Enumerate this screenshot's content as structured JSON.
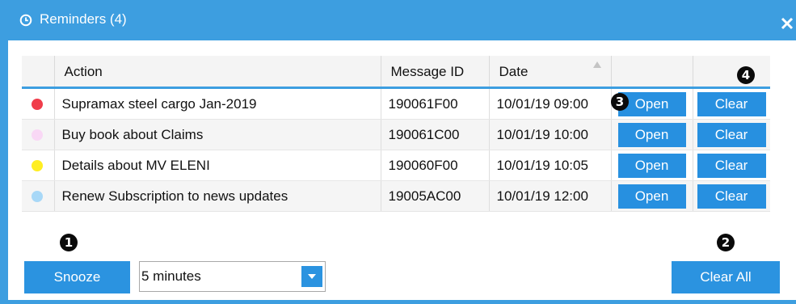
{
  "dialog": {
    "title": "Reminders (4)",
    "title_icon": "clock-icon",
    "close_icon": "close-icon"
  },
  "table": {
    "columns": [
      "",
      "Action",
      "Message ID",
      "Date",
      "",
      ""
    ],
    "sort_icon": "sort-ascending-icon",
    "rows": [
      {
        "color": "#f03d4b",
        "action": "Supramax steel cargo Jan-2019",
        "message_id": "190061F00",
        "date": "10/01/19 09:00",
        "open_label": "Open",
        "clear_label": "Clear"
      },
      {
        "color": "#f9d8f5",
        "action": "Buy book about Claims",
        "message_id": "190061C00",
        "date": "10/01/19 10:00",
        "open_label": "Open",
        "clear_label": "Clear"
      },
      {
        "color": "#ffee22",
        "action": "Details about MV ELENI",
        "message_id": "190060F00",
        "date": "10/01/19 10:05",
        "open_label": "Open",
        "clear_label": "Clear"
      },
      {
        "color": "#a8d8f7",
        "action": "Renew Subscription to news updates",
        "message_id": "19005AC00",
        "date": "10/01/19 12:00",
        "open_label": "Open",
        "clear_label": "Clear"
      }
    ]
  },
  "footer": {
    "snooze_label": "Snooze",
    "snooze_value": "5 minutes",
    "clear_all_label": "Clear All"
  },
  "markers": [
    "1",
    "2",
    "3",
    "4"
  ],
  "colors": {
    "accent": "#3d9ee0",
    "button": "#2790e0",
    "marker": "#0a0a0a"
  }
}
